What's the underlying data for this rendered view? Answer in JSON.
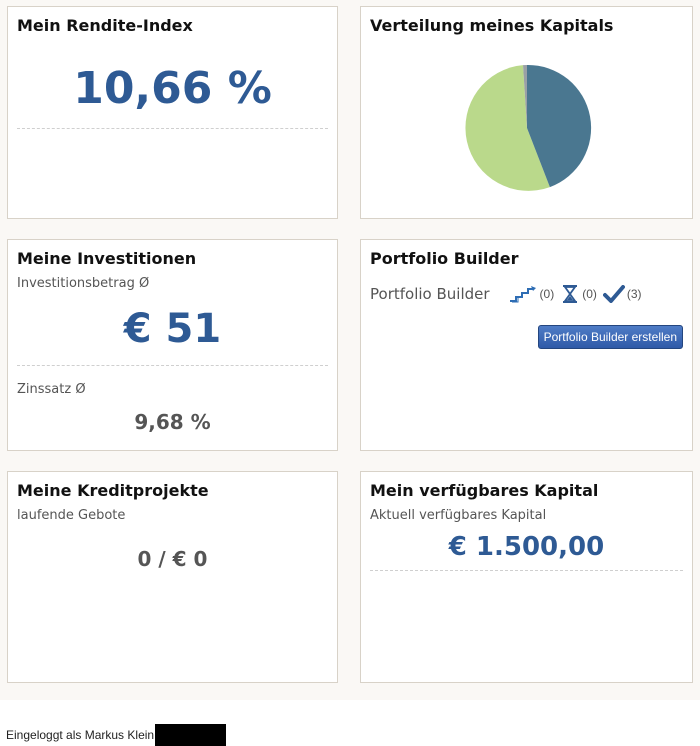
{
  "rendite": {
    "title": "Mein Rendite-Index",
    "value": "10,66 %"
  },
  "verteilung": {
    "title": "Verteilung meines Kapitals",
    "colors": {
      "a": "#4a7790",
      "b": "#bad98b",
      "c": "#9aa0a6"
    }
  },
  "investitionen": {
    "title": "Meine Investitionen",
    "betrag_label": "Investitionsbetrag Ø",
    "betrag_value": "€ 51",
    "zins_label": "Zinssatz Ø",
    "zins_value": "9,68 %"
  },
  "portfolio": {
    "title": "Portfolio Builder",
    "label": "Portfolio Builder",
    "stats": [
      {
        "icon": "stairs-icon",
        "count": "(0)"
      },
      {
        "icon": "hourglass-icon",
        "count": "(0)"
      },
      {
        "icon": "checkmark-icon",
        "count": "(3)"
      }
    ],
    "button_label": "Portfolio Builder erstellen"
  },
  "kredit": {
    "title": "Meine Kreditprojekte",
    "label": "laufende Gebote",
    "value": "0 / € 0"
  },
  "kapital": {
    "title": "Mein verfügbares Kapital",
    "label": "Aktuell verfügbares Kapital",
    "value": "€ 1.500,00"
  },
  "footer": {
    "text": "Eingeloggt als Markus Klein"
  }
}
